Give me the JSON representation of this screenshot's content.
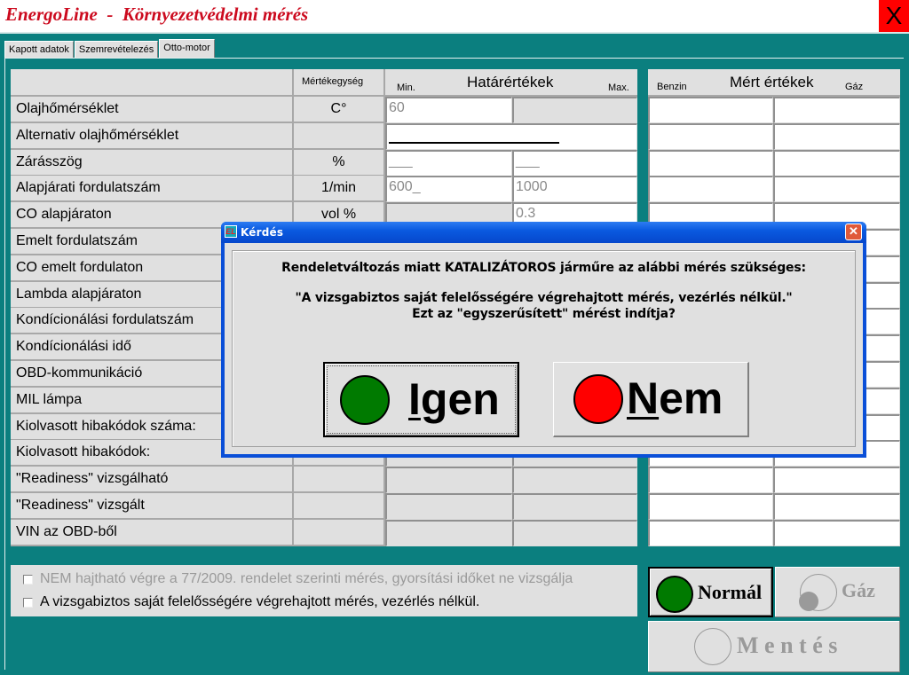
{
  "app": {
    "title": "EnergoLine  -  Környezetvédelmi mérés",
    "close_label": "X"
  },
  "tabs": [
    {
      "label": "Kapott adatok",
      "active": false
    },
    {
      "label": "Szemrevételezés",
      "active": false
    },
    {
      "label": "Otto-motor",
      "active": true
    }
  ],
  "limits_table": {
    "header": {
      "unit": "Mértékegység",
      "min": "Min.",
      "group": "Határértékek",
      "max": "Max."
    },
    "rows": [
      {
        "label": "Olajhőmérséklet",
        "unit": "C°",
        "min": "60",
        "max": ""
      },
      {
        "label": "Alternativ olajhőmérséklet",
        "unit": "",
        "min": "",
        "max": ""
      },
      {
        "label": "Zárásszög",
        "unit": "%",
        "min": "___",
        "max": "___"
      },
      {
        "label": "Alapjárati fordulatszám",
        "unit": "1/min",
        "min": "600_",
        "max": "1000"
      },
      {
        "label": "CO alapjáraton",
        "unit": "vol %",
        "min": "",
        "max": "0.3"
      },
      {
        "label": "Emelt fordulatszám",
        "unit": "",
        "min": "",
        "max": ""
      },
      {
        "label": "CO emelt fordulaton",
        "unit": "",
        "min": "",
        "max": ""
      },
      {
        "label": "Lambda alapjáraton",
        "unit": "",
        "min": "",
        "max": ""
      },
      {
        "label": "Kondícionálási fordulatszám",
        "unit": "",
        "min": "",
        "max": ""
      },
      {
        "label": "Kondícionálási idő",
        "unit": "",
        "min": "",
        "max": ""
      },
      {
        "label": "OBD-kommunikáció",
        "unit": "",
        "min": "",
        "max": ""
      },
      {
        "label": "MIL lámpa",
        "unit": "",
        "min": "",
        "max": ""
      },
      {
        "label": "Kiolvasott hibakódok száma:",
        "unit": "",
        "min": "",
        "max": ""
      },
      {
        "label": "Kiolvasott hibakódok:",
        "unit": "",
        "min": "",
        "max": ""
      },
      {
        "label": "\"Readiness\" vizsgálható",
        "unit": "",
        "min": "",
        "max": ""
      },
      {
        "label": "\"Readiness\" vizsgált",
        "unit": "",
        "min": "",
        "max": ""
      },
      {
        "label": "VIN az OBD-ből",
        "unit": "",
        "min": "",
        "max": ""
      }
    ]
  },
  "measured_table": {
    "header": {
      "benzin": "Benzin",
      "group": "Mért értékek",
      "gaz": "Gáz"
    }
  },
  "options": {
    "checkbox1": {
      "label": "NEM hajtható végre a 77/2009. rendelet szerinti mérés, gyorsítási időket ne vizsgálja",
      "checked": false,
      "disabled": true
    },
    "checkbox2": {
      "label": "A vizsgabiztos saját felelősségére végrehajtott mérés, vezérlés nélkül.",
      "checked": false,
      "disabled": false
    }
  },
  "mode_buttons": {
    "normal": {
      "label": "Normál",
      "color": "#007a00"
    },
    "gaz": {
      "label": "Gáz"
    },
    "save": {
      "label": "M e n t é s"
    }
  },
  "dialog": {
    "title": "Kérdés",
    "icon_text": "EL",
    "line1": "Rendeletváltozás miatt KATALIZÁTOROS járműre az alábbi mérés szükséges:",
    "line2": "\"A vizsgabiztos saját felelősségére végrehajtott mérés, vezérlés nélkül.\"",
    "line3": "Ezt az \"egyszerűsített\" mérést indítja?",
    "yes": {
      "first": "I",
      "rest": "gen",
      "color": "#007a00"
    },
    "no": {
      "first": "N",
      "rest": "em",
      "color": "#ff0000"
    },
    "close_label": "✕"
  },
  "colors": {
    "background": "#0b7f7f",
    "title": "#cc0a1e",
    "close_box": "#ff0000"
  }
}
